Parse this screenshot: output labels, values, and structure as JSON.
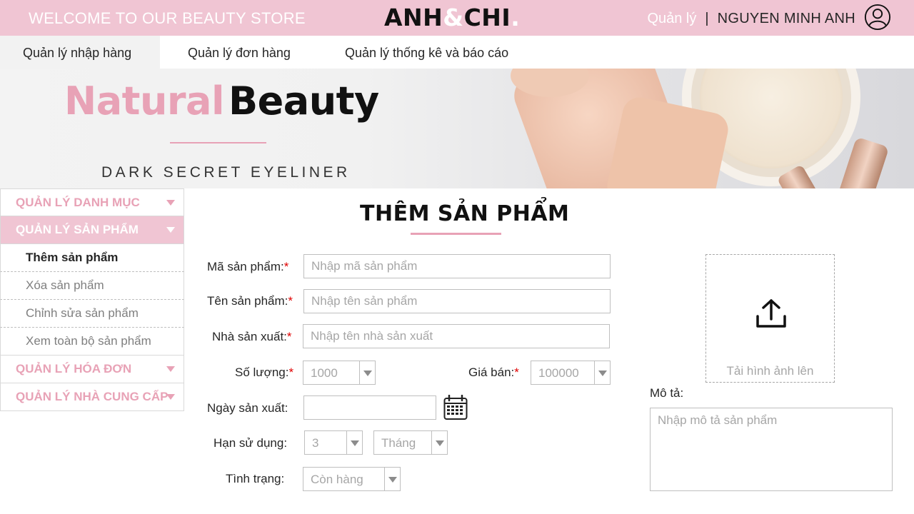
{
  "header": {
    "welcome": "WELCOME TO OUR BEAUTY STORE",
    "logo_part1": "ANH",
    "logo_amp": "&",
    "logo_part2": "CHI",
    "logo_dot": ".",
    "manage_link": "Quản lý",
    "separator": "|",
    "username": "NGUYEN MINH ANH",
    "avatar_icon": "user-circle-icon"
  },
  "nav": {
    "tabs": [
      {
        "label": "Quản lý nhập hàng",
        "active": true
      },
      {
        "label": "Quản lý đơn hàng",
        "active": false
      },
      {
        "label": "Quản lý thống kê và báo cáo",
        "active": false
      }
    ]
  },
  "banner": {
    "title_part1": "Natural",
    "title_part2": "Beauty",
    "subtitle": "DARK SECRET EYELINER"
  },
  "sidebar": {
    "items": [
      {
        "label": "QUẢN LÝ DANH MỤC",
        "open": false
      },
      {
        "label": "QUẢN LÝ SẢN PHẨM",
        "open": true,
        "subitems": [
          {
            "label": "Thêm sản phẩm",
            "active": true
          },
          {
            "label": "Xóa sản phẩm",
            "active": false
          },
          {
            "label": "Chỉnh sửa sản phẩm",
            "active": false
          },
          {
            "label": "Xem toàn bộ sản phẩm",
            "active": false
          }
        ]
      },
      {
        "label": "QUẢN LÝ HÓA ĐƠN",
        "open": false
      },
      {
        "label": "QUẢN LÝ NHÀ CUNG CẤP",
        "open": false
      }
    ]
  },
  "form": {
    "title": "THÊM SẢN PHẨM",
    "required_mark": "*",
    "product_code": {
      "label": "Mã sản phẩm:",
      "placeholder": "Nhập mã sản phẩm"
    },
    "product_name": {
      "label": "Tên sản phẩm:",
      "placeholder": "Nhập tên sản phẩm"
    },
    "manufacturer": {
      "label": "Nhà sản xuất:",
      "placeholder": "Nhập tên nhà sản xuất"
    },
    "quantity": {
      "label": "Số lượng:",
      "value": "1000"
    },
    "price": {
      "label": "Giá bán:",
      "value": "100000"
    },
    "mfg_date": {
      "label": "Ngày sản xuất:",
      "value": "",
      "icon": "calendar-icon"
    },
    "expiry": {
      "label": "Hạn sử dụng:",
      "value": "3",
      "unit": "Tháng"
    },
    "status": {
      "label": "Tình trạng:",
      "value": "Còn hàng"
    },
    "upload": {
      "label": "Tải hình ảnh lên",
      "icon": "upload-icon"
    },
    "description": {
      "label": "Mô tả:",
      "placeholder": "Nhập mô tả sản phẩm"
    }
  },
  "colors": {
    "brand_pink": "#f0c5d3",
    "accent_pink": "#e8a2b6",
    "required_red": "#e00000"
  }
}
